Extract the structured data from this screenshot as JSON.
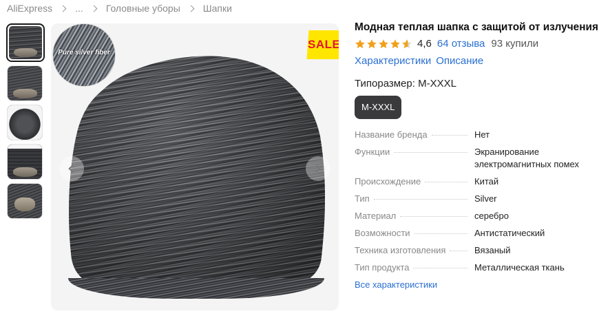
{
  "breadcrumb": {
    "items": [
      "AliExpress",
      "...",
      "Головные уборы",
      "Шапки"
    ]
  },
  "gallery": {
    "thumbnail_count": 5,
    "active_index": 0,
    "badge_text": "Pure silver fiber",
    "sale_text": "SALE",
    "prev_icon": "chevron-left-icon",
    "next_icon": "chevron-right-icon"
  },
  "product": {
    "title": "Модная теплая шапка с защитой от излучения",
    "rating_value": 4.6,
    "rating": "4,6",
    "star_color": "#f2a01b",
    "reviews": "64 отзыва",
    "bought": "93 купили",
    "links": [
      "Характеристики",
      "Описание"
    ],
    "size_label": "Типоразмер: M-XXXL",
    "size_option": "M-XXXL"
  },
  "specs": [
    {
      "key": "Название бренда",
      "value": "Нет"
    },
    {
      "key": "Функции",
      "value": "Экранирование электромагнитных помех"
    },
    {
      "key": "Происхождение",
      "value": "Китай"
    },
    {
      "key": "Тип",
      "value": "Silver"
    },
    {
      "key": "Материал",
      "value": "серебро"
    },
    {
      "key": "Возможности",
      "value": "Антистатический"
    },
    {
      "key": "Техника изготовления",
      "value": "Вязаный"
    },
    {
      "key": "Тип продукта",
      "value": "Металлическая ткань"
    }
  ],
  "all_specs_link": "Все характеристики",
  "colors": {
    "link": "#2a6fd1",
    "chip_bg": "#3a3a3c",
    "sale_bg": "#ffe600",
    "sale_text": "#e4162c"
  }
}
